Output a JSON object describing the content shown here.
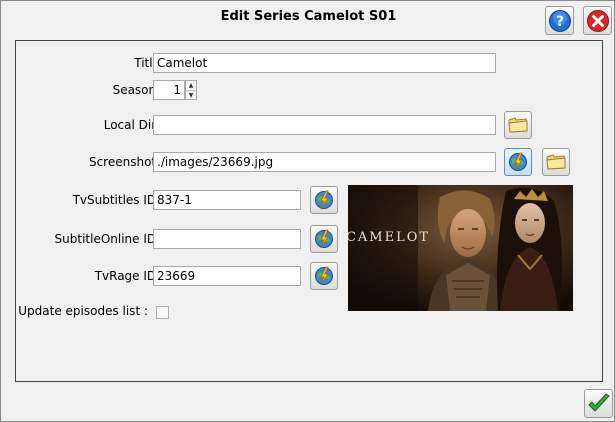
{
  "window": {
    "title": "Edit Series Camelot S01",
    "help_icon": "help-question-icon",
    "close_icon": "close-x-icon"
  },
  "form": {
    "title_label": "Title:",
    "title_value": "Camelot",
    "season_label": "Season :",
    "season_value": "1",
    "local_dir_label": "Local Dir :",
    "local_dir_value": "",
    "screenshot_label": "Screenshot :",
    "screenshot_value": "./images/23669.jpg",
    "tvsubtitles_label": "TvSubtitles ID :",
    "tvsubtitles_value": "837-1",
    "subtitleonline_label": "SubtitleOnline ID :",
    "subtitleonline_value": "",
    "tvrage_label": "TvRage ID :",
    "tvrage_value": "23669",
    "update_episodes_label": "Update episodes list :",
    "update_episodes_checked": false
  },
  "poster": {
    "caption": "CAMELOT"
  },
  "footer": {
    "ok_icon": "checkmark-icon"
  },
  "colors": {
    "help_blue": "#1e6fd0",
    "close_red": "#d9262a",
    "ok_green": "#3aa935",
    "folder_yellow": "#f2d77a"
  }
}
